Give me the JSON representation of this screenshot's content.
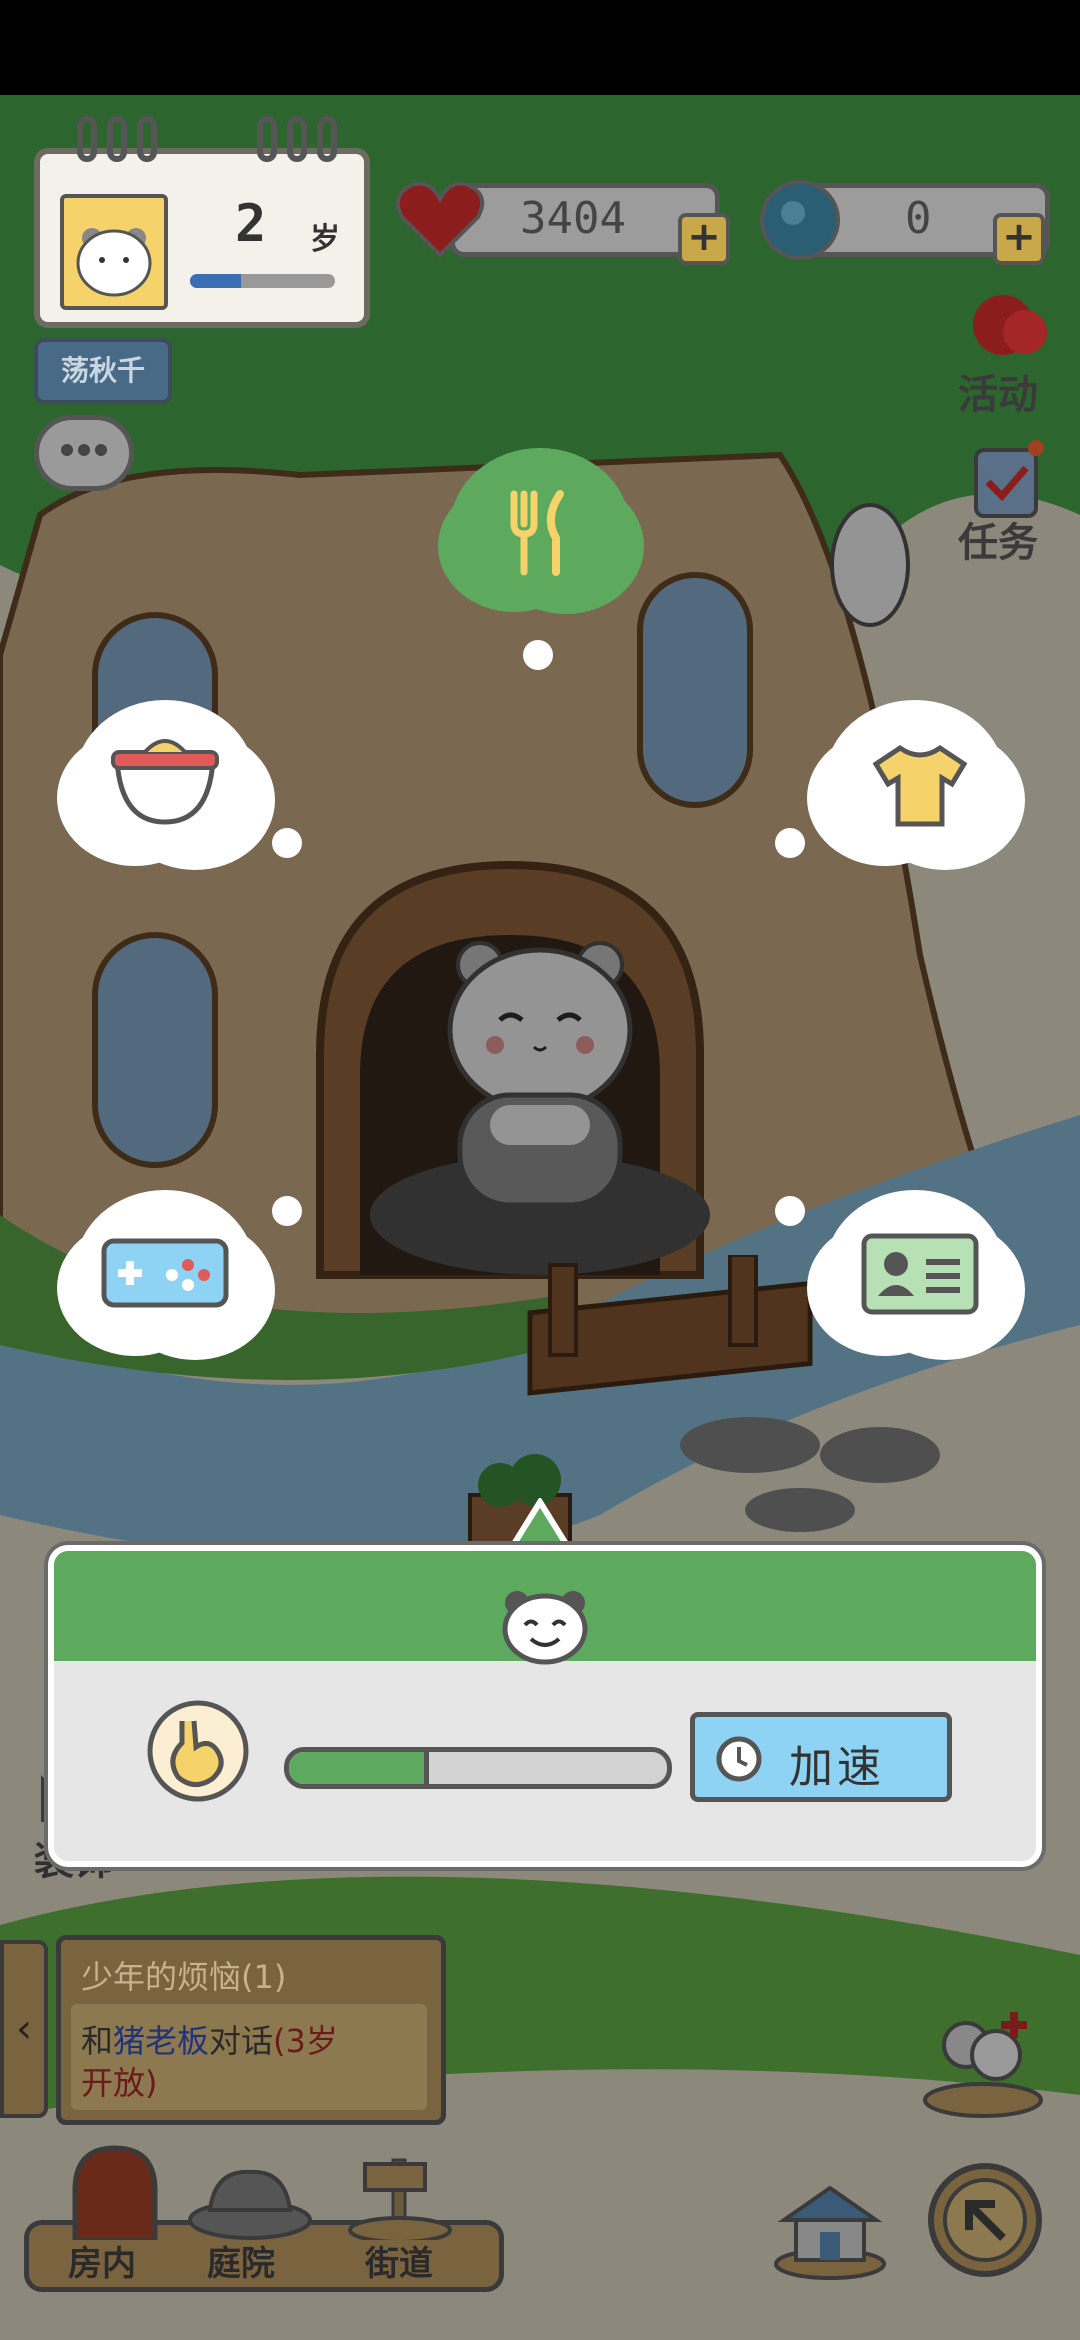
{
  "profile": {
    "age": "2",
    "age_unit": "岁",
    "growth_progress": 0.35
  },
  "currency": {
    "hearts": "3404",
    "gems": "0"
  },
  "labels": {
    "swing": "荡秋千",
    "activity": "活动",
    "tasks": "任务",
    "decorate": "装饰",
    "room": "房内",
    "yard": "庭院",
    "street": "街道"
  },
  "quest": {
    "title": "少年的烦恼(1)",
    "line1_a": "和",
    "line1_b": "猪老板",
    "line1_c": "对话",
    "line1_d": "(3岁",
    "line2": "开放)"
  },
  "panel": {
    "speedup_label": "加速",
    "hunger_progress": 0.37
  },
  "colors": {
    "green": "#5daa5f",
    "blue": "#8fd3f4",
    "panel_bg": "#e6e6e6"
  },
  "icons": {
    "menu": [
      "fork-knife-icon",
      "food-bowl-icon",
      "shirt-icon",
      "gamepad-icon",
      "id-card-icon"
    ]
  }
}
